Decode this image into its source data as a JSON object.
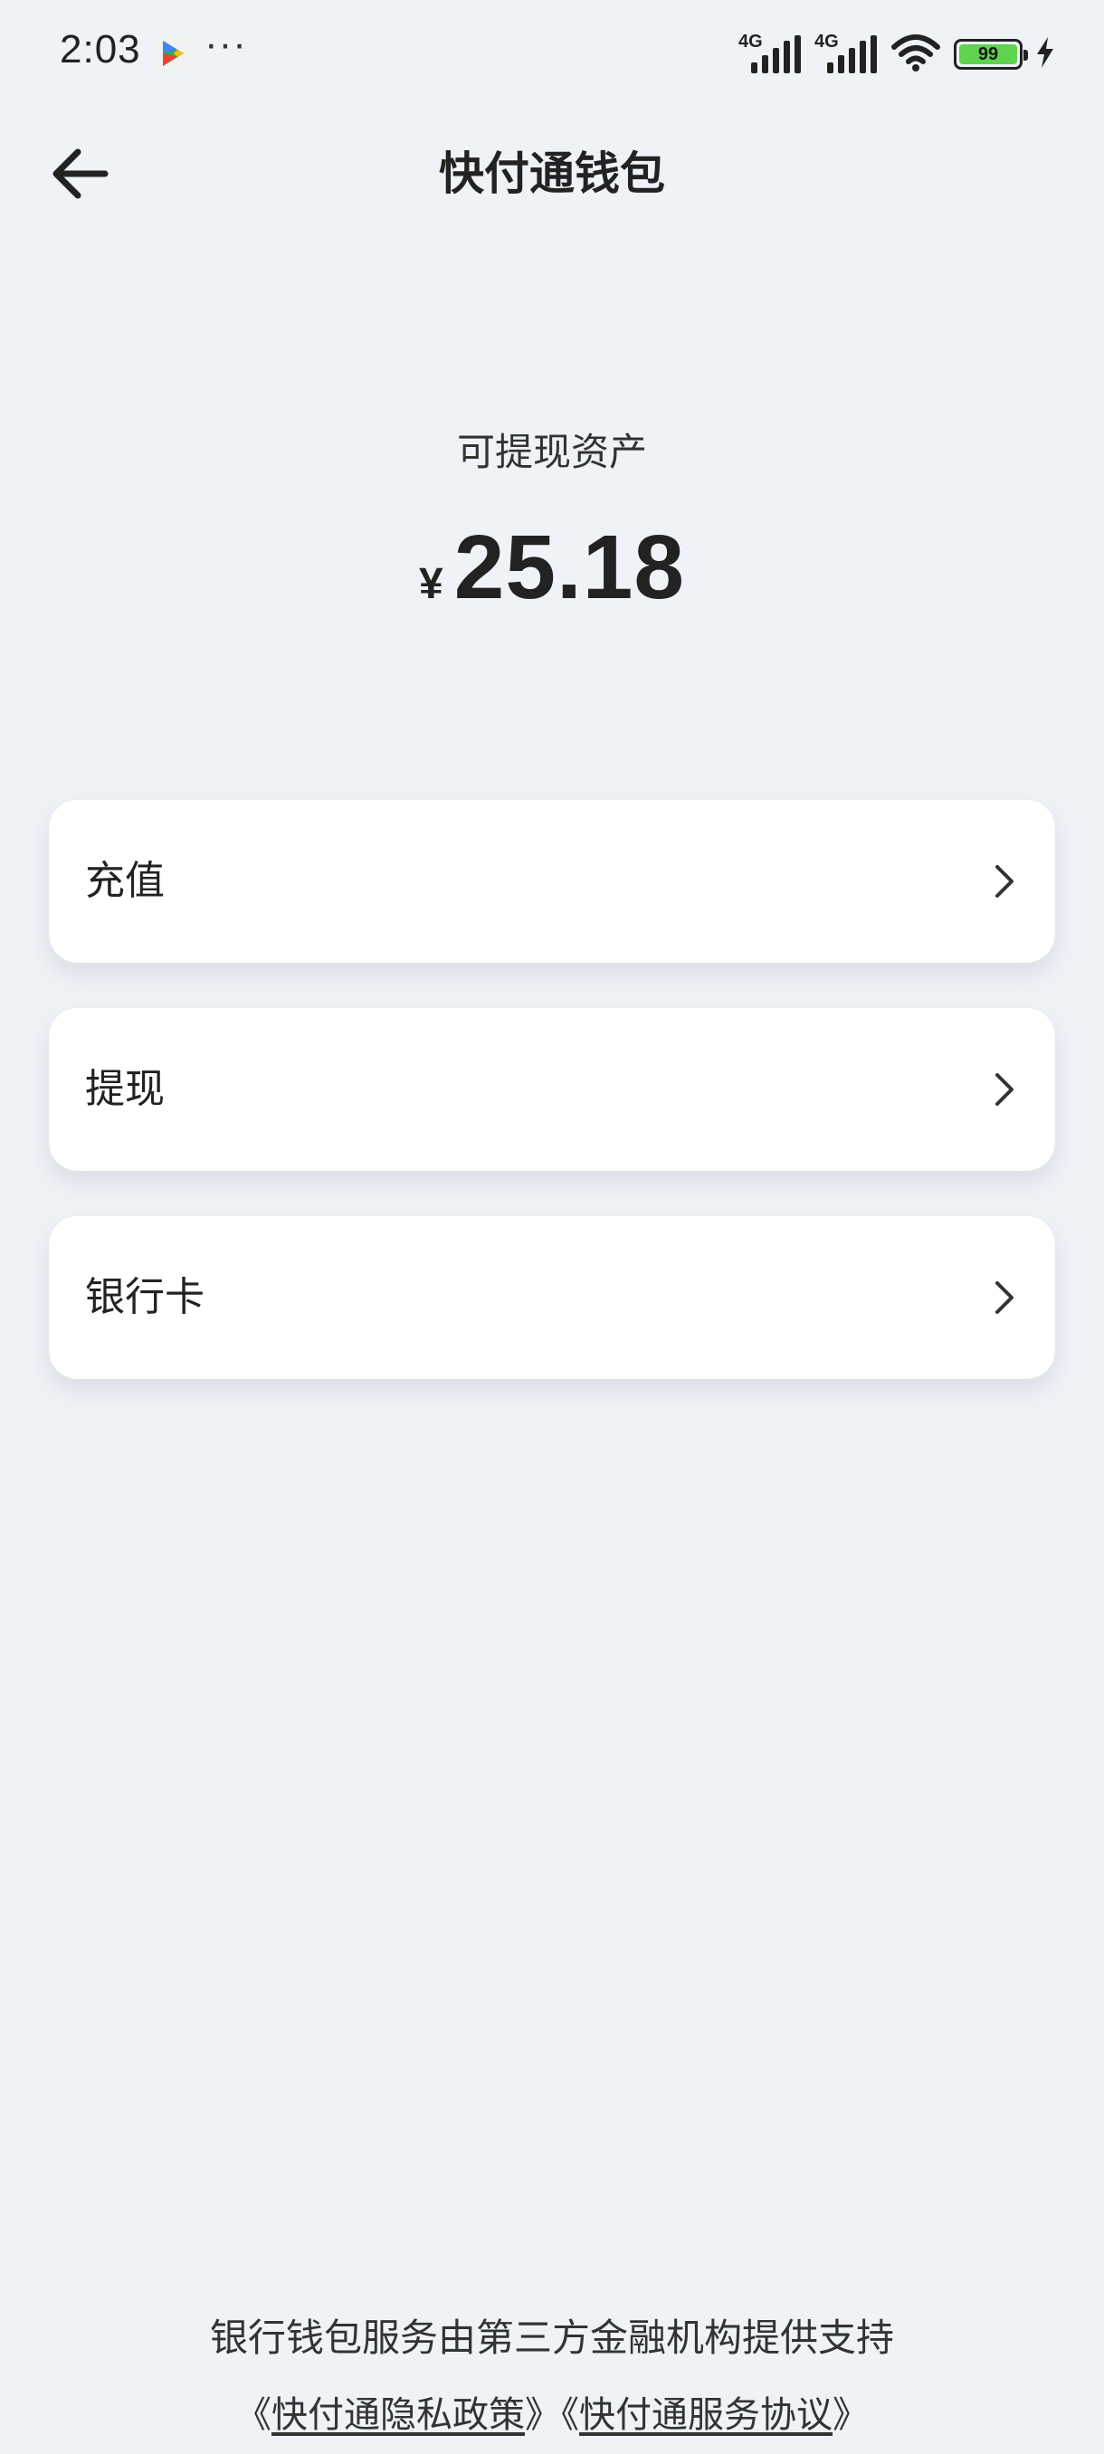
{
  "status_bar": {
    "time": "2:03",
    "more": "···",
    "signal1_label": "4G",
    "signal2_label": "4G",
    "battery_level": "99"
  },
  "header": {
    "title": "快付通钱包"
  },
  "balance": {
    "label": "可提现资产",
    "currency": "¥",
    "amount": "25.18"
  },
  "menu": {
    "items": [
      {
        "label": "充值"
      },
      {
        "label": "提现"
      },
      {
        "label": "银行卡"
      }
    ]
  },
  "footer": {
    "note": "银行钱包服务由第三方金融机构提供支持",
    "open1": "《",
    "privacy_link": "快付通隐私政策",
    "close1": "》",
    "open2": "《",
    "service_link": "快付通服务协议",
    "close2": "》"
  }
}
